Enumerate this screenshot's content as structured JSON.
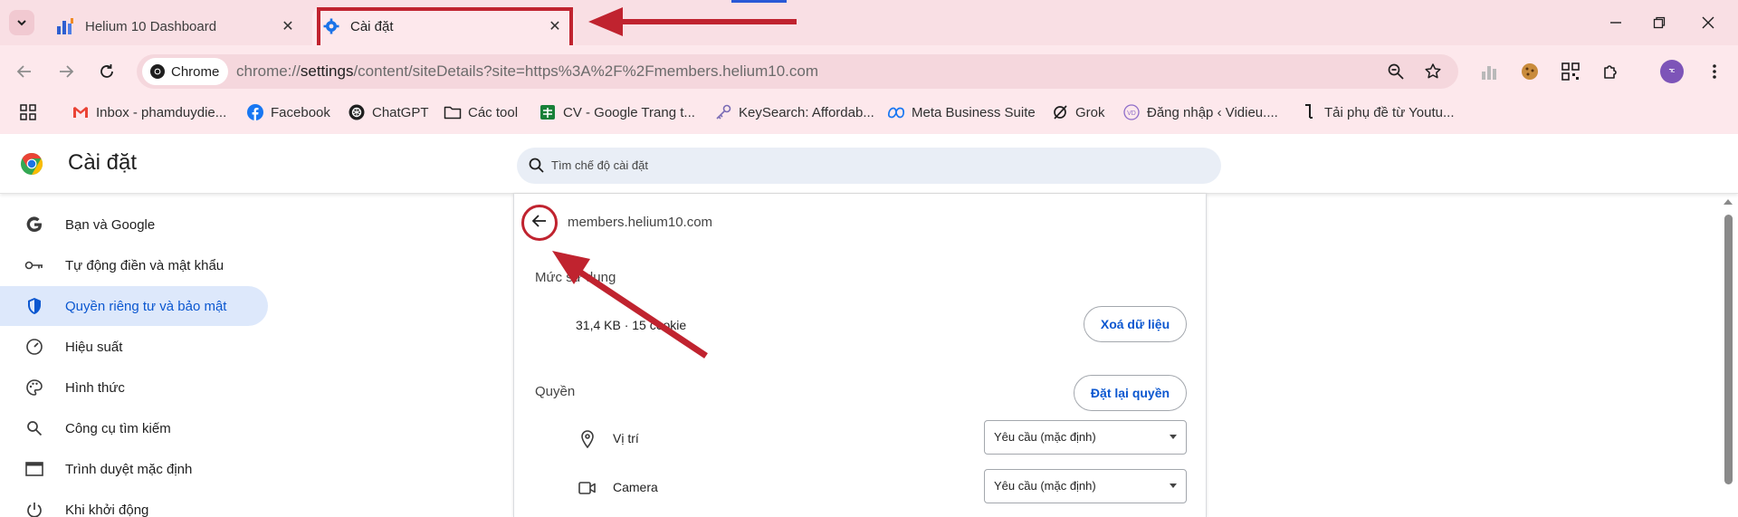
{
  "browser": {
    "tabs": [
      {
        "title": "Helium 10 Dashboard",
        "active": false
      },
      {
        "title": "Cài đặt",
        "active": true
      }
    ],
    "chip_label": "Chrome",
    "url_prefix": "chrome://",
    "url_host": "settings",
    "url_rest": "/content/siteDetails?site=https%3A%2F%2Fmembers.helium10.com",
    "avatar_text": "ᄀᄃ",
    "annotation_color": "#c0232f",
    "accent_color": "#0b57d0"
  },
  "bookmarks": [
    {
      "label": "Inbox - phamduydie...",
      "icon": "gmail-icon"
    },
    {
      "label": "Facebook",
      "icon": "facebook-icon"
    },
    {
      "label": "ChatGPT",
      "icon": "chatgpt-icon"
    },
    {
      "label": "Các tool",
      "icon": "folder-icon"
    },
    {
      "label": "CV - Google Trang t...",
      "icon": "google-sheets-icon"
    },
    {
      "label": "KeySearch: Affordab...",
      "icon": "key-icon"
    },
    {
      "label": "Meta Business Suite",
      "icon": "meta-icon"
    },
    {
      "label": "Grok",
      "icon": "grok-icon"
    },
    {
      "label": "Đăng nhập ‹ Vidieu....",
      "icon": "vidieu-icon"
    },
    {
      "label": "Tải phụ đề từ Youtu...",
      "icon": "subtitle-icon"
    }
  ],
  "settings": {
    "title": "Cài đặt",
    "search_placeholder": "Tìm chế độ cài đặt"
  },
  "sidebar": {
    "items": [
      {
        "label": "Bạn và Google",
        "icon": "google-icon",
        "active": false
      },
      {
        "label": "Tự động điền và mật khẩu",
        "icon": "key-icon",
        "active": false
      },
      {
        "label": "Quyền riêng tư và bảo mật",
        "icon": "shield-icon",
        "active": true
      },
      {
        "label": "Hiệu suất",
        "icon": "speedometer-icon",
        "active": false
      },
      {
        "label": "Hình thức",
        "icon": "palette-icon",
        "active": false
      },
      {
        "label": "Công cụ tìm kiếm",
        "icon": "search-icon",
        "active": false
      },
      {
        "label": "Trình duyệt mặc định",
        "icon": "browser-window-icon",
        "active": false
      },
      {
        "label": "Khi khởi động",
        "icon": "power-icon",
        "active": false
      }
    ]
  },
  "site_details": {
    "site": "members.helium10.com",
    "usage_label": "Mức sử dụng",
    "usage_value": "31,4 KB · 15 cookie",
    "clear_button": "Xoá dữ liệu",
    "permissions_label": "Quyền",
    "reset_button": "Đặt lại quyền",
    "permissions": [
      {
        "label": "Vị trí",
        "icon": "location-pin-icon",
        "value": "Yêu cầu (mặc định)"
      },
      {
        "label": "Camera",
        "icon": "camera-icon",
        "value": "Yêu cầu (mặc định)"
      }
    ]
  }
}
